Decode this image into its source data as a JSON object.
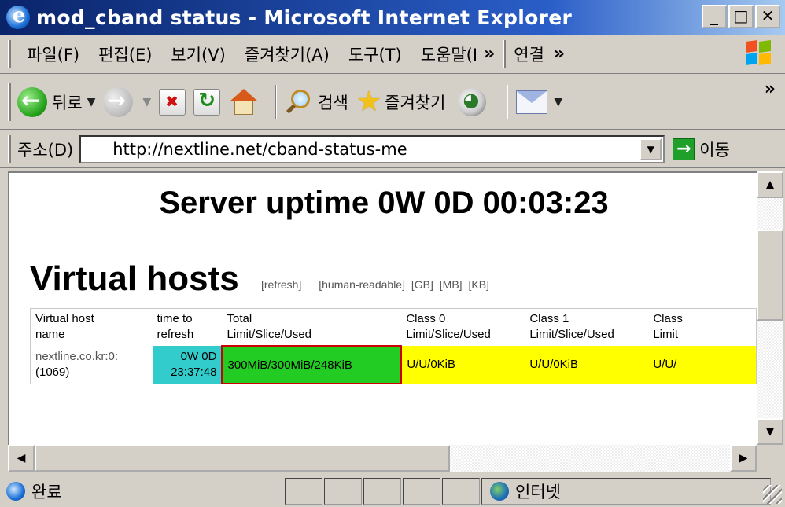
{
  "window": {
    "title": "mod_cband status - Microsoft Internet Explorer",
    "controls": [
      "_",
      "□",
      "✕"
    ]
  },
  "menu": {
    "items": [
      "파일(F)",
      "편집(E)",
      "보기(V)",
      "즐겨찾기(A)",
      "도구(T)",
      "도움말(I"
    ],
    "more": "»",
    "links_label": "연결",
    "links_more": "»"
  },
  "toolbar": {
    "back_label": "뒤로",
    "search_label": "검색",
    "favorites_label": "즐겨찾기",
    "more": "»"
  },
  "address": {
    "label": "주소(D)",
    "url": "http://nextline.net/cband-status-me",
    "go_label": "이동"
  },
  "page": {
    "uptime": "Server uptime 0W 0D 00:03:23",
    "heading": "Virtual hosts",
    "links": [
      "[refresh]",
      "[human-readable]",
      "[GB]",
      "[MB]",
      "[KB]"
    ],
    "table": {
      "headers": [
        [
          "Virtual host",
          "name"
        ],
        [
          "time to",
          "refresh"
        ],
        [
          "Total",
          "Limit/Slice/Used"
        ],
        [
          "Class 0",
          "Limit/Slice/Used"
        ],
        [
          "Class 1",
          "Limit/Slice/Used"
        ],
        [
          "Class",
          "Limit"
        ]
      ],
      "row": {
        "host": "nextline.co.kr:0:",
        "host_id": "(1069)",
        "time_line1": "0W 0D",
        "time_line2": "23:37:48",
        "total": "300MiB/300MiB/248KiB",
        "class0": "U/U/0KiB",
        "class1": "U/U/0KiB",
        "class2": "U/U/"
      }
    }
  },
  "status": {
    "text": "완료",
    "zone": "인터넷"
  },
  "colors": {
    "time_cell": "#33cccc",
    "total_cell": "#22cc22",
    "class_cell": "#ffff00",
    "total_border": "#cc0000"
  }
}
